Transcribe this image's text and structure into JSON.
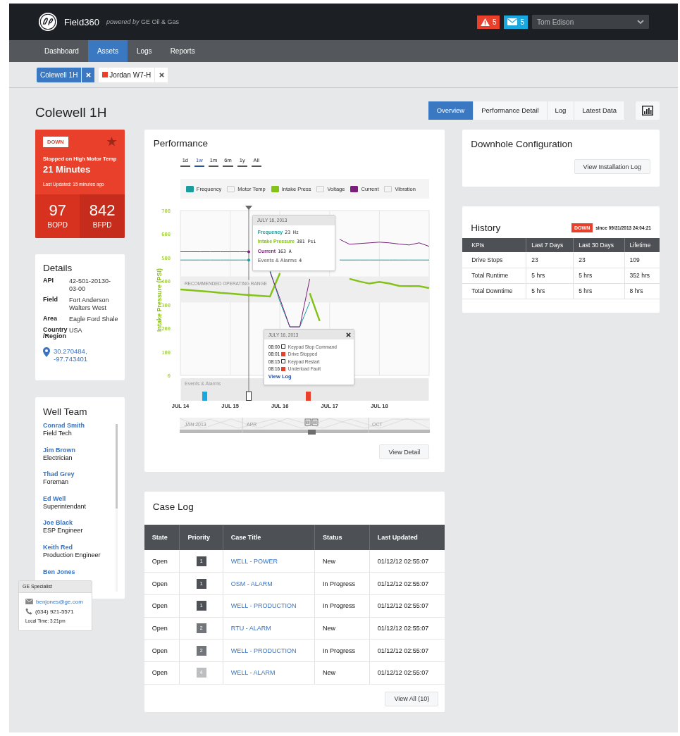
{
  "header": {
    "product": "Field360",
    "tagline": "*powered by* GE Oil & Gas",
    "alerts": "5",
    "messages": "5",
    "user": "Tom Edison"
  },
  "nav": [
    {
      "label": "Dashboard",
      "selected": false
    },
    {
      "label": "Assets",
      "selected": true
    },
    {
      "label": "Logs",
      "selected": false
    },
    {
      "label": "Reports",
      "selected": false
    }
  ],
  "asset_tabs": [
    {
      "label": "Colewell 1H",
      "selected": true
    },
    {
      "label": "Jordan W7-H",
      "selected": false,
      "color": "#e8402a"
    }
  ],
  "title": "Colewell 1H",
  "views": [
    {
      "label": "Overview",
      "selected": true
    },
    {
      "label": "Performance Detail",
      "selected": false
    },
    {
      "label": "Log",
      "selected": false
    },
    {
      "label": "Latest Data",
      "selected": false
    }
  ],
  "status": {
    "state": "DOWN",
    "reason": "Stopped on High Motor Temp",
    "duration": "21 Minutes",
    "updated": "Last Updated: 15 minutes ago",
    "metrics": [
      {
        "value": "97",
        "unit": "BOPD"
      },
      {
        "value": "842",
        "unit": "BFPD"
      }
    ]
  },
  "details": {
    "title": "Details",
    "fields": [
      {
        "label": "API",
        "value": "42-501-20130-03-00"
      },
      {
        "label": "Field",
        "value": "Fort Anderson Walters West"
      },
      {
        "label": "Area",
        "value": "Eagle Ford Shale"
      },
      {
        "label": "Country /Region",
        "value": "USA"
      }
    ],
    "location": "30.270484, -97.743401"
  },
  "team": {
    "title": "Well Team",
    "members": [
      {
        "name": "Conrad Smith",
        "role": "Field Tech"
      },
      {
        "name": "Jim Brown",
        "role": "Electrician"
      },
      {
        "name": "Thad Grey",
        "role": "Foreman"
      },
      {
        "name": "Ed Well",
        "role": "Superintendant"
      },
      {
        "name": "Joe Black",
        "role": "ESP Engineer"
      },
      {
        "name": "Keith Red",
        "role": "Production Engineer"
      },
      {
        "name": "Ben Jones"
      }
    ]
  },
  "specialist": {
    "title": "GE Specialist",
    "email": "benjones@ge.com",
    "phone": "(634) 921-5571",
    "local_time": "Local Time: 3:21pm"
  },
  "performance": {
    "title": "Performance",
    "ranges": [
      {
        "label": "1d",
        "selected": false
      },
      {
        "label": "1w",
        "selected": true
      },
      {
        "label": "1m",
        "selected": false
      },
      {
        "label": "6m",
        "selected": false
      },
      {
        "label": "1y",
        "selected": false
      },
      {
        "label": "All",
        "selected": false
      }
    ],
    "legend": [
      {
        "kind": "series"
      },
      {
        "kind": "toggle",
        "label": "Motor Temp",
        "on": false
      },
      {
        "kind": "series"
      },
      {
        "kind": "toggle",
        "label": "Voltage",
        "on": false
      },
      {
        "kind": "series"
      },
      {
        "kind": "toggle",
        "label": "Vibration",
        "on": false
      }
    ],
    "events_strip": {
      "label": "Events & Alarms",
      "markers": [
        {
          "kind": "event",
          "color": "#1aa7e0"
        },
        {
          "kind": "cursor"
        },
        {
          "kind": "event",
          "color": "#e8402a"
        }
      ]
    },
    "chart_data": {
      "type": "line",
      "ylabel": "Intake Pressure (PSI)",
      "ylim": [
        0,
        700
      ],
      "grid": true,
      "bands": [
        {
          "axis": "y",
          "from": 310,
          "to": 420,
          "label": "RECOMMENDED OPERATING RANGE"
        }
      ],
      "categories": [
        "JUL 14",
        null,
        null,
        null,
        null,
        "JUL 15",
        null,
        null,
        null,
        null,
        "JUL 16",
        null,
        null,
        null,
        null,
        "JUL 17",
        null,
        null,
        null,
        null,
        "JUL 18",
        null,
        null,
        null,
        null,
        null
      ],
      "yticks": [
        0,
        100,
        200,
        300,
        400,
        500,
        600,
        700
      ],
      "series": [
        {
          "name": "Frequency",
          "color": "#1a9c9c",
          "values": [
            490,
            490,
            490,
            490,
            490,
            490,
            490,
            490,
            null,
            446,
            314,
            206,
            206,
            311,
            null,
            null,
            490,
            490,
            490,
            490,
            490,
            490,
            490,
            490,
            490,
            490
          ]
        },
        {
          "name": "Intake Press",
          "color": "#84c21a",
          "values": [
            365,
            362,
            358,
            355,
            351,
            348,
            344,
            341,
            338,
            335,
            434,
            null,
            null,
            349,
            231,
            null,
            null,
            410,
            399,
            390,
            397,
            390,
            380,
            379,
            379,
            371
          ]
        },
        {
          "name": "Current",
          "color": "#7a1f7a",
          "values": [
            525,
            525,
            525,
            525,
            525,
            525,
            525,
            525,
            null,
            440,
            326,
            206,
            206,
            410,
            null,
            null,
            578,
            557,
            560,
            563,
            566,
            563,
            558,
            554,
            563,
            548
          ]
        }
      ]
    },
    "hover": {
      "date": "JULY 16, 2013",
      "lines": [
        {
          "label": "Frequency",
          "value": "23 Hz",
          "color": "#1a9c9c"
        },
        {
          "label": "Intake Pressure",
          "value": "381 Psi",
          "color": "#84c21a"
        },
        {
          "label": "Current",
          "value": "163 A",
          "color": "#7a1f7a"
        },
        {
          "label": "Events & Alarms",
          "value": "4",
          "color": "#888888"
        }
      ]
    },
    "events_popup": {
      "date": "JULY 16, 2013",
      "events": [
        {
          "time": "08:00",
          "kind": "event",
          "label": "Keypad Stop Command"
        },
        {
          "time": "08:01",
          "kind": "alarm",
          "label": "Drive Stopped"
        },
        {
          "time": "08:15",
          "kind": "event",
          "label": "Keypad Restart"
        },
        {
          "time": "08:16",
          "kind": "alarm",
          "label": "Underload Fault"
        }
      ],
      "link": "View Log"
    },
    "navigator": {
      "labels": [
        "JAN 2013",
        "APR",
        "OCT"
      ]
    },
    "button": "View Detail"
  },
  "case_log": {
    "title": "Case Log",
    "columns": [
      "State",
      "Priority",
      "Case Title",
      "Status",
      "Last Updated"
    ],
    "rows": [
      {
        "state": "Open",
        "priority": "1",
        "color": "#4d5055",
        "title": "WELL - POWER",
        "status": "New",
        "updated": "01/12/12 02:55:07"
      },
      {
        "state": "Open",
        "priority": "1",
        "color": "#4d5055",
        "title": "OSM - ALARM",
        "status": "In Progress",
        "updated": "01/12/12 02:55:07"
      },
      {
        "state": "Open",
        "priority": "1",
        "color": "#4d5055",
        "title": "WELL - PRODUCTION",
        "status": "In Progress",
        "updated": "01/12/12 02:55:07"
      },
      {
        "state": "Open",
        "priority": "2",
        "color": "#727579",
        "title": "RTU - ALARM",
        "status": "New",
        "updated": "01/12/12 02:55:07"
      },
      {
        "state": "Open",
        "priority": "2",
        "color": "#727579",
        "title": "WELL - PRODUCTION",
        "status": "In Progress",
        "updated": "01/12/12 02:55:07"
      },
      {
        "state": "Open",
        "priority": "4",
        "color": "#bcbec0",
        "title": "WELL - ALARM",
        "status": "New",
        "updated": "01/12/12 02:55:07"
      }
    ],
    "button": "View All (10)"
  },
  "downhole": {
    "title": "Downhole Configuration",
    "button": "View Installation Log"
  },
  "history": {
    "title": "History",
    "state": "DOWN",
    "since": "since 09/31/2013 24:04:21",
    "columns": [
      "KPIs",
      "Last 7 Days",
      "Last 30 Days",
      "Lifetime"
    ],
    "rows": [
      [
        "Drive Stops",
        "23",
        "23",
        "109"
      ],
      [
        "Total Runtime",
        "5 hrs",
        "5 hrs",
        "352 hrs"
      ],
      [
        "Total Downtime",
        "5 hrs",
        "5 hrs",
        "8 hrs"
      ]
    ]
  }
}
